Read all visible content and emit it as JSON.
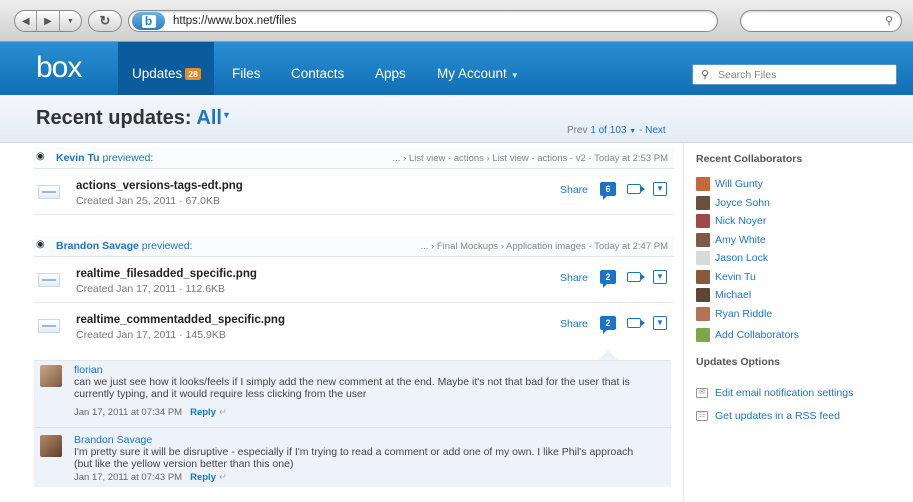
{
  "browser": {
    "url": "https://www.box.net/files",
    "favicon_letter": "b",
    "search_value": ""
  },
  "header": {
    "logo": "box",
    "nav": [
      {
        "label": "Updates",
        "badge": "28",
        "active": true
      },
      {
        "label": "Files"
      },
      {
        "label": "Contacts"
      },
      {
        "label": "Apps"
      },
      {
        "label": "My Account"
      }
    ],
    "search_placeholder": "Search Files"
  },
  "page": {
    "title": "Recent updates:",
    "filter": "All",
    "pager": {
      "prev": "Prev",
      "range": "1 of 103",
      "next": "Next"
    }
  },
  "events": [
    {
      "user": "Kevin Tu",
      "action": "previewed:",
      "path": "... › List view - actions › List view - actions - v2",
      "time": "Today at 2:53 PM",
      "files": [
        {
          "name": "actions_versions-tags-edt.png",
          "meta": "Created Jan 25, 2011  ·  67.0KB",
          "share": "Share",
          "comments": "6"
        }
      ]
    },
    {
      "user": "Brandon Savage",
      "action": "previewed:",
      "path": "... › Final Mockups › Application images",
      "time": "Today at 2:47 PM",
      "files": [
        {
          "name": "realtime_filesadded_specific.png",
          "meta": "Created Jan 17, 2011  ·  112.6KB",
          "share": "Share",
          "comments": "2"
        },
        {
          "name": "realtime_commentadded_specific.png",
          "meta": "Created Jan 17, 2011  ·  145.9KB",
          "share": "Share",
          "comments": "2"
        }
      ]
    }
  ],
  "comments": [
    {
      "author": "florian",
      "text": "can we just see how it looks/feels if I simply add the new comment at the end. Maybe it's not that bad for the user that is currently typing, and it would require less clicking from the user",
      "date": "Jan 17, 2011 at 07:34 PM",
      "reply": "Reply"
    },
    {
      "author": "Brandon Savage",
      "text": "I'm pretty sure it will be disruptive - especially if I'm trying to read a comment or add one of my own. I like Phil's approach (but like the yellow version better than this one)",
      "date": "Jan 17, 2011 at 07:43 PM",
      "reply": "Reply"
    }
  ],
  "sidebar": {
    "collab_heading": "Recent Collaborators",
    "collaborators": [
      {
        "name": "Will Gunty",
        "color": "#c46a3a"
      },
      {
        "name": "Joyce Sohn",
        "color": "#6b4f3a"
      },
      {
        "name": "Nick Noyer",
        "color": "#a04848"
      },
      {
        "name": "Amy White",
        "color": "#7d5a44"
      },
      {
        "name": "Jason Lock",
        "color": "#d9d9d9"
      },
      {
        "name": "Kevin Tu",
        "color": "#8a5a3c"
      },
      {
        "name": "Michael",
        "color": "#5e4636"
      },
      {
        "name": "Ryan Riddle",
        "color": "#b27452"
      }
    ],
    "add_collab": "Add Collaborators",
    "options_heading": "Updates Options",
    "options": [
      {
        "label": "Edit email notification settings",
        "icon": "envelope-icon"
      },
      {
        "label": "Get updates in a RSS feed",
        "icon": "rss-icon"
      }
    ]
  }
}
